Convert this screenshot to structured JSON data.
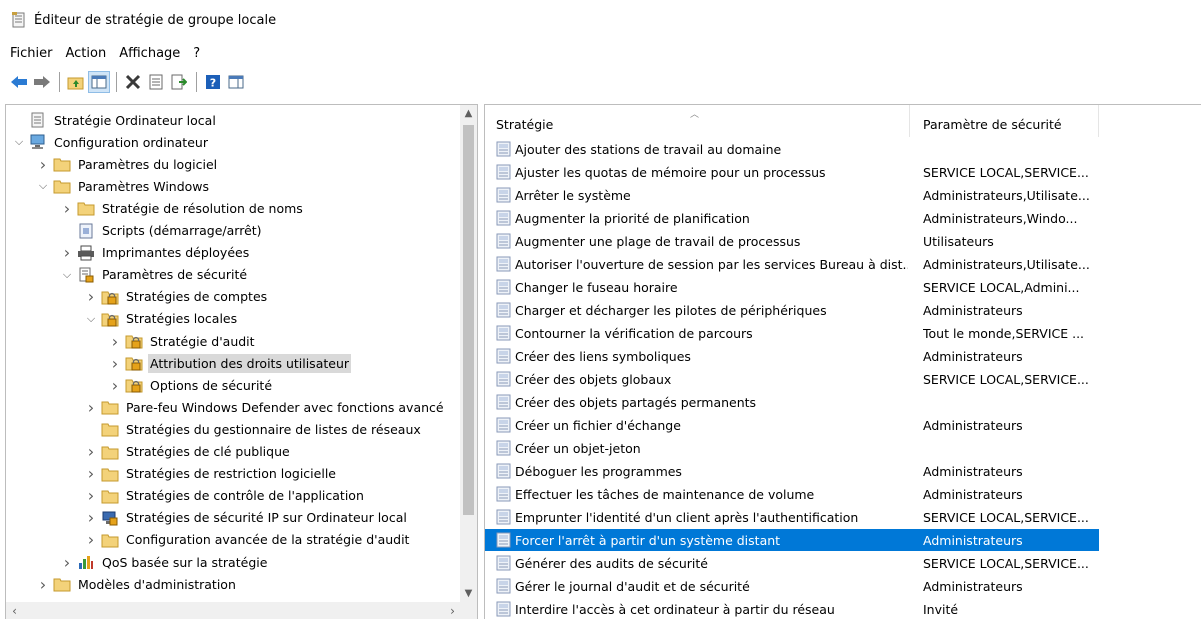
{
  "window": {
    "title": "Éditeur de stratégie de groupe locale"
  },
  "menu": [
    "Fichier",
    "Action",
    "Affichage",
    "?"
  ],
  "toolbar": [
    "back-arrow-icon",
    "forward-arrow-icon",
    "up-folder-icon",
    "show-hide-tree-icon",
    "delete-icon",
    "properties-icon",
    "export-list-icon",
    "help-icon",
    "show-pane-icon"
  ],
  "tree": [
    {
      "label": "Stratégie Ordinateur local",
      "chev": "",
      "icon": "policy-doc-icon",
      "level": 0
    },
    {
      "label": "Configuration ordinateur",
      "chev": "expanded",
      "icon": "computer-icon",
      "level": 0
    },
    {
      "label": "Paramètres du logiciel",
      "chev": "collapsed",
      "icon": "folder-icon",
      "level": 1
    },
    {
      "label": "Paramètres Windows",
      "chev": "expanded",
      "icon": "folder-icon",
      "level": 1
    },
    {
      "label": "Stratégie de résolution de noms",
      "chev": "collapsed",
      "icon": "folder-icon",
      "level": 2
    },
    {
      "label": "Scripts (démarrage/arrêt)",
      "chev": "",
      "icon": "script-icon",
      "level": 2
    },
    {
      "label": "Imprimantes déployées",
      "chev": "collapsed",
      "icon": "printer-icon",
      "level": 2
    },
    {
      "label": "Paramètres de sécurité",
      "chev": "expanded",
      "icon": "security-settings-icon",
      "level": 2
    },
    {
      "label": "Stratégies de comptes",
      "chev": "collapsed",
      "icon": "security-folder-icon",
      "level": 3
    },
    {
      "label": "Stratégies locales",
      "chev": "expanded",
      "icon": "security-folder-icon",
      "level": 3
    },
    {
      "label": "Stratégie d'audit",
      "chev": "collapsed",
      "icon": "security-folder-icon",
      "level": 4
    },
    {
      "label": "Attribution des droits utilisateur",
      "chev": "collapsed",
      "icon": "security-folder-icon",
      "level": 4,
      "selected": true
    },
    {
      "label": "Options de sécurité",
      "chev": "collapsed",
      "icon": "security-folder-icon",
      "level": 4
    },
    {
      "label": "Pare-feu Windows Defender avec fonctions avancé",
      "chev": "collapsed",
      "icon": "folder-icon",
      "level": 3
    },
    {
      "label": "Stratégies du gestionnaire de listes de réseaux",
      "chev": "",
      "icon": "folder-icon",
      "level": 3
    },
    {
      "label": "Stratégies de clé publique",
      "chev": "collapsed",
      "icon": "folder-icon",
      "level": 3
    },
    {
      "label": "Stratégies de restriction logicielle",
      "chev": "collapsed",
      "icon": "folder-icon",
      "level": 3
    },
    {
      "label": "Stratégies de contrôle de l'application",
      "chev": "collapsed",
      "icon": "folder-icon",
      "level": 3
    },
    {
      "label": "Stratégies de sécurité IP sur Ordinateur local",
      "chev": "collapsed",
      "icon": "ip-security-icon",
      "level": 3
    },
    {
      "label": "Configuration avancée de la stratégie d'audit",
      "chev": "collapsed",
      "icon": "folder-icon",
      "level": 3
    },
    {
      "label": "QoS basée sur la stratégie",
      "chev": "collapsed",
      "icon": "qos-chart-icon",
      "level": 2
    },
    {
      "label": "Modèles d'administration",
      "chev": "collapsed",
      "icon": "folder-icon",
      "level": 1
    }
  ],
  "list": {
    "headers": {
      "policy": "Stratégie",
      "setting": "Paramètre de sécurité"
    },
    "rows": [
      {
        "name": "Ajouter des stations de travail au domaine",
        "value": ""
      },
      {
        "name": "Ajuster les quotas de mémoire pour un processus",
        "value": "SERVICE LOCAL,SERVICE..."
      },
      {
        "name": "Arrêter le système",
        "value": "Administrateurs,Utilisate..."
      },
      {
        "name": "Augmenter la priorité de planification",
        "value": "Administrateurs,Windo..."
      },
      {
        "name": "Augmenter une plage de travail de processus",
        "value": "Utilisateurs"
      },
      {
        "name": "Autoriser l'ouverture de session par les services Bureau à dist...",
        "value": "Administrateurs,Utilisate..."
      },
      {
        "name": "Changer le fuseau horaire",
        "value": "SERVICE LOCAL,Admini..."
      },
      {
        "name": "Charger et décharger les pilotes de périphériques",
        "value": "Administrateurs"
      },
      {
        "name": "Contourner la vérification de parcours",
        "value": "Tout le monde,SERVICE ..."
      },
      {
        "name": "Créer des liens symboliques",
        "value": "Administrateurs"
      },
      {
        "name": "Créer des objets globaux",
        "value": "SERVICE LOCAL,SERVICE..."
      },
      {
        "name": "Créer des objets partagés permanents",
        "value": ""
      },
      {
        "name": "Créer un fichier d'échange",
        "value": "Administrateurs"
      },
      {
        "name": "Créer un objet-jeton",
        "value": ""
      },
      {
        "name": "Déboguer les programmes",
        "value": "Administrateurs"
      },
      {
        "name": "Effectuer les tâches de maintenance de volume",
        "value": "Administrateurs"
      },
      {
        "name": "Emprunter l'identité d'un client après l'authentification",
        "value": "SERVICE LOCAL,SERVICE..."
      },
      {
        "name": "Forcer l'arrêt à partir d'un système distant",
        "value": "Administrateurs",
        "selected": true
      },
      {
        "name": "Générer des audits de sécurité",
        "value": "SERVICE LOCAL,SERVICE..."
      },
      {
        "name": "Gérer le journal d'audit et de sécurité",
        "value": "Administrateurs"
      },
      {
        "name": "Interdire l'accès à cet ordinateur à partir du réseau",
        "value": "Invité"
      }
    ]
  },
  "colors": {
    "selection": "#0078d7",
    "tree_selection": "#d9d9d9",
    "folder": "#f3d27a",
    "help": "#1c5fb8"
  }
}
